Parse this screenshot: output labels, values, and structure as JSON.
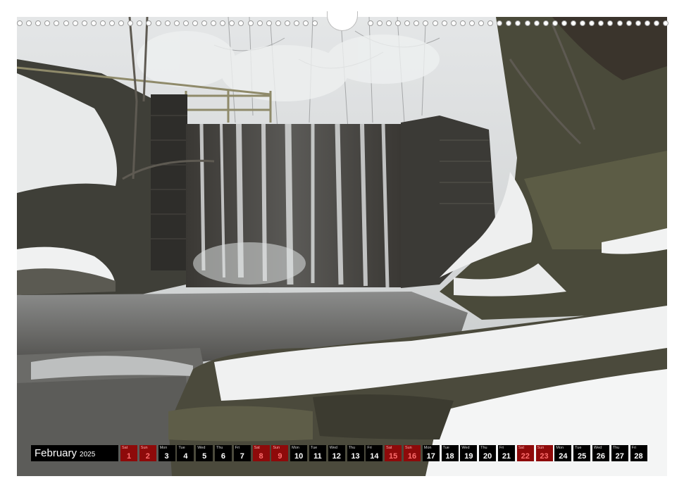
{
  "photo": {
    "subject": "snowy-waterfall",
    "palette": {
      "sky": "#d9dbdc",
      "forest": "#c9cccd",
      "rock_dark": "#2f2d2a",
      "water": "#6e6e6c",
      "snow": "#f2f3f3",
      "moss": "#5a5a3e"
    }
  },
  "calendar": {
    "month": "February",
    "year": "2025",
    "weekend_color": "#8e0a0a",
    "days": [
      {
        "dow": "Sat",
        "num": "1",
        "weekend": true
      },
      {
        "dow": "Sun",
        "num": "2",
        "weekend": true
      },
      {
        "dow": "Mon",
        "num": "3",
        "weekend": false
      },
      {
        "dow": "Tue",
        "num": "4",
        "weekend": false
      },
      {
        "dow": "Wed",
        "num": "5",
        "weekend": false
      },
      {
        "dow": "Thu",
        "num": "6",
        "weekend": false
      },
      {
        "dow": "Fri",
        "num": "7",
        "weekend": false
      },
      {
        "dow": "Sat",
        "num": "8",
        "weekend": true
      },
      {
        "dow": "Sun",
        "num": "9",
        "weekend": true
      },
      {
        "dow": "Mon",
        "num": "10",
        "weekend": false
      },
      {
        "dow": "Tue",
        "num": "11",
        "weekend": false
      },
      {
        "dow": "Wed",
        "num": "12",
        "weekend": false
      },
      {
        "dow": "Thu",
        "num": "13",
        "weekend": false
      },
      {
        "dow": "Fri",
        "num": "14",
        "weekend": false
      },
      {
        "dow": "Sat",
        "num": "15",
        "weekend": true
      },
      {
        "dow": "Sun",
        "num": "16",
        "weekend": true
      },
      {
        "dow": "Mon",
        "num": "17",
        "weekend": false
      },
      {
        "dow": "Tue",
        "num": "18",
        "weekend": false
      },
      {
        "dow": "Wed",
        "num": "19",
        "weekend": false
      },
      {
        "dow": "Thu",
        "num": "20",
        "weekend": false
      },
      {
        "dow": "Fri",
        "num": "21",
        "weekend": false
      },
      {
        "dow": "Sat",
        "num": "22",
        "weekend": true
      },
      {
        "dow": "Sun",
        "num": "23",
        "weekend": true
      },
      {
        "dow": "Mon",
        "num": "24",
        "weekend": false
      },
      {
        "dow": "Tue",
        "num": "25",
        "weekend": false
      },
      {
        "dow": "Wed",
        "num": "26",
        "weekend": false
      },
      {
        "dow": "Thu",
        "num": "27",
        "weekend": false
      },
      {
        "dow": "Fri",
        "num": "28",
        "weekend": false
      }
    ]
  }
}
